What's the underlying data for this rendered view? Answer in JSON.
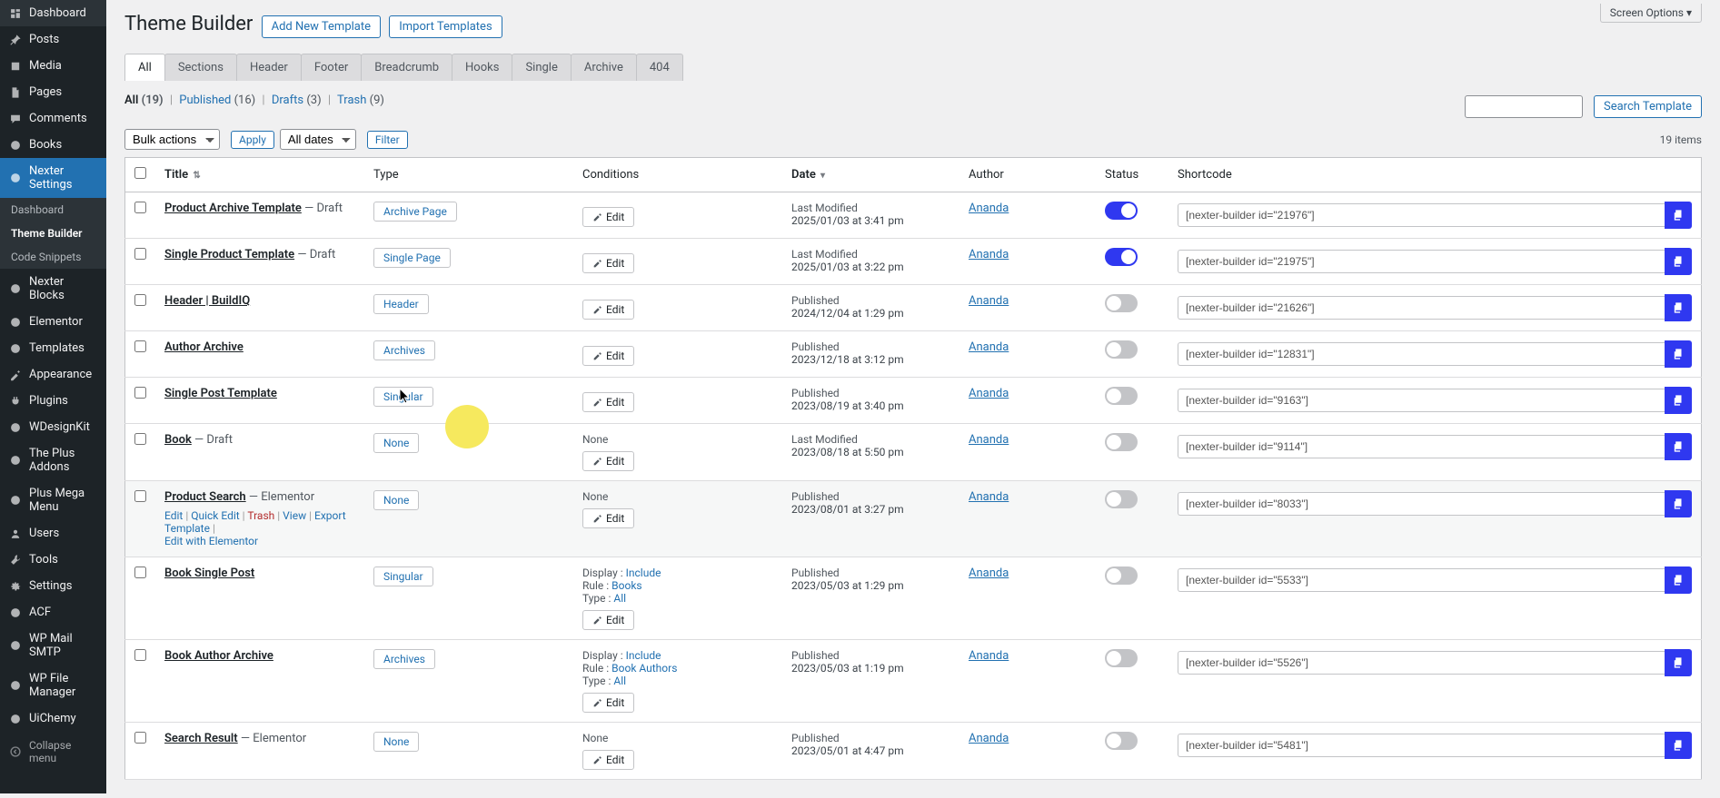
{
  "screen_options": "Screen Options ▾",
  "page_title": "Theme Builder",
  "buttons": {
    "add_new": "Add New Template",
    "import": "Import Templates",
    "apply": "Apply",
    "filter": "Filter",
    "search": "Search Template"
  },
  "type_tabs": [
    "All",
    "Sections",
    "Header",
    "Footer",
    "Breadcrumb",
    "Hooks",
    "Single",
    "Archive",
    "404"
  ],
  "status_filters": {
    "all": {
      "label": "All",
      "count": "(19)"
    },
    "published": {
      "label": "Published",
      "count": "(16)"
    },
    "drafts": {
      "label": "Drafts",
      "count": "(3)"
    },
    "trash": {
      "label": "Trash",
      "count": "(9)"
    }
  },
  "bulk_label": "Bulk actions",
  "dates_label": "All dates",
  "items_count": "19 items",
  "columns": {
    "title": "Title",
    "type": "Type",
    "conditions": "Conditions",
    "date": "Date",
    "author": "Author",
    "status": "Status",
    "shortcode": "Shortcode"
  },
  "sort_indicator_title": "⇅",
  "sort_indicator_date": "▾",
  "edit_label": "Edit",
  "row_actions": {
    "edit": "Edit",
    "quick": "Quick Edit",
    "trash": "Trash",
    "view": "View",
    "export": "Export Template",
    "elementor": "Edit with Elementor"
  },
  "cond_labels": {
    "display": "Display :",
    "rule": "Rule :",
    "type": "Type :"
  },
  "rows": [
    {
      "title": "Product Archive Template",
      "suffix": " — Draft",
      "type": "Archive Page",
      "cond_none": false,
      "cond": [],
      "date1": "Last Modified",
      "date2": "2025/01/03 at 3:41 pm",
      "author": "Ananda",
      "status": true,
      "short": "[nexter-builder id=\"21976\"]",
      "hover": false
    },
    {
      "title": "Single Product Template",
      "suffix": " — Draft",
      "type": "Single Page",
      "cond_none": false,
      "cond": [],
      "date1": "Last Modified",
      "date2": "2025/01/03 at 3:22 pm",
      "author": "Ananda",
      "status": true,
      "short": "[nexter-builder id=\"21975\"]",
      "hover": false
    },
    {
      "title": "Header | BuildIQ",
      "suffix": "",
      "type": "Header",
      "cond_none": false,
      "cond": [],
      "date1": "Published",
      "date2": "2024/12/04 at 1:29 pm",
      "author": "Ananda",
      "status": false,
      "short": "[nexter-builder id=\"21626\"]",
      "hover": false
    },
    {
      "title": "Author Archive",
      "suffix": "",
      "type": "Archives",
      "cond_none": false,
      "cond": [],
      "date1": "Published",
      "date2": "2023/12/18 at 3:12 pm",
      "author": "Ananda",
      "status": false,
      "short": "[nexter-builder id=\"12831\"]",
      "hover": false
    },
    {
      "title": "Single Post Template",
      "suffix": "",
      "type": "Singular",
      "cond_none": false,
      "cond": [],
      "date1": "Published",
      "date2": "2023/08/19 at 3:40 pm",
      "author": "Ananda",
      "status": false,
      "short": "[nexter-builder id=\"9163\"]",
      "hover": false
    },
    {
      "title": "Book",
      "suffix": " — Draft",
      "type": "None",
      "cond_none": true,
      "cond_none_text": "None",
      "cond": [],
      "date1": "Last Modified",
      "date2": "2023/08/18 at 5:50 pm",
      "author": "Ananda",
      "status": false,
      "short": "[nexter-builder id=\"9114\"]",
      "hover": false
    },
    {
      "title": "Product Search",
      "suffix": " — Elementor",
      "type": "None",
      "cond_none": true,
      "cond_none_text": "None",
      "cond": [],
      "date1": "Published",
      "date2": "2023/08/01 at 3:27 pm",
      "author": "Ananda",
      "status": false,
      "short": "[nexter-builder id=\"8033\"]",
      "hover": true
    },
    {
      "title": "Book Single Post",
      "suffix": "",
      "type": "Singular",
      "cond_none": false,
      "cond": [
        [
          "Include",
          "Books",
          "All"
        ]
      ],
      "date1": "Published",
      "date2": "2023/05/03 at 1:29 pm",
      "author": "Ananda",
      "status": false,
      "short": "[nexter-builder id=\"5533\"]",
      "hover": false
    },
    {
      "title": "Book Author Archive",
      "suffix": "",
      "type": "Archives",
      "cond_none": false,
      "cond": [
        [
          "Include",
          "Book Authors",
          "All"
        ]
      ],
      "date1": "Published",
      "date2": "2023/05/03 at 1:19 pm",
      "author": "Ananda",
      "status": false,
      "short": "[nexter-builder id=\"5526\"]",
      "hover": false
    },
    {
      "title": "Search Result",
      "suffix": " — Elementor",
      "type": "None",
      "cond_none": true,
      "cond_none_text": "None",
      "cond": [],
      "date1": "Published",
      "date2": "2023/05/01 at 4:47 pm",
      "author": "Ananda",
      "status": false,
      "short": "[nexter-builder id=\"5481\"]",
      "hover": false
    }
  ],
  "sidebar": {
    "items": [
      {
        "label": "Dashboard",
        "icon": "dashboard-icon"
      },
      {
        "label": "Posts",
        "icon": "pin-icon"
      },
      {
        "label": "Media",
        "icon": "media-icon"
      },
      {
        "label": "Pages",
        "icon": "pages-icon"
      },
      {
        "label": "Comments",
        "icon": "comments-icon"
      },
      {
        "label": "Books",
        "icon": "books-icon"
      },
      {
        "label": "Nexter Settings",
        "icon": "nexter-icon",
        "current": true
      },
      {
        "label": "Nexter Blocks",
        "icon": "blocks-icon"
      },
      {
        "label": "Elementor",
        "icon": "elementor-icon"
      },
      {
        "label": "Templates",
        "icon": "templates-icon"
      },
      {
        "label": "Appearance",
        "icon": "appearance-icon"
      },
      {
        "label": "Plugins",
        "icon": "plugins-icon"
      },
      {
        "label": "WDesignKit",
        "icon": "wdesignkit-icon"
      },
      {
        "label": "The Plus Addons",
        "icon": "plus-icon"
      },
      {
        "label": "Plus Mega Menu",
        "icon": "mega-icon"
      },
      {
        "label": "Users",
        "icon": "users-icon"
      },
      {
        "label": "Tools",
        "icon": "tools-icon"
      },
      {
        "label": "Settings",
        "icon": "settings-icon"
      },
      {
        "label": "ACF",
        "icon": "acf-icon"
      },
      {
        "label": "WP Mail SMTP",
        "icon": "mail-icon"
      },
      {
        "label": "WP File Manager",
        "icon": "file-icon"
      },
      {
        "label": "UiChemy",
        "icon": "uichemy-icon"
      }
    ],
    "submenu": [
      "Dashboard",
      "Theme Builder",
      "Code Snippets"
    ],
    "collapse": "Collapse menu"
  }
}
